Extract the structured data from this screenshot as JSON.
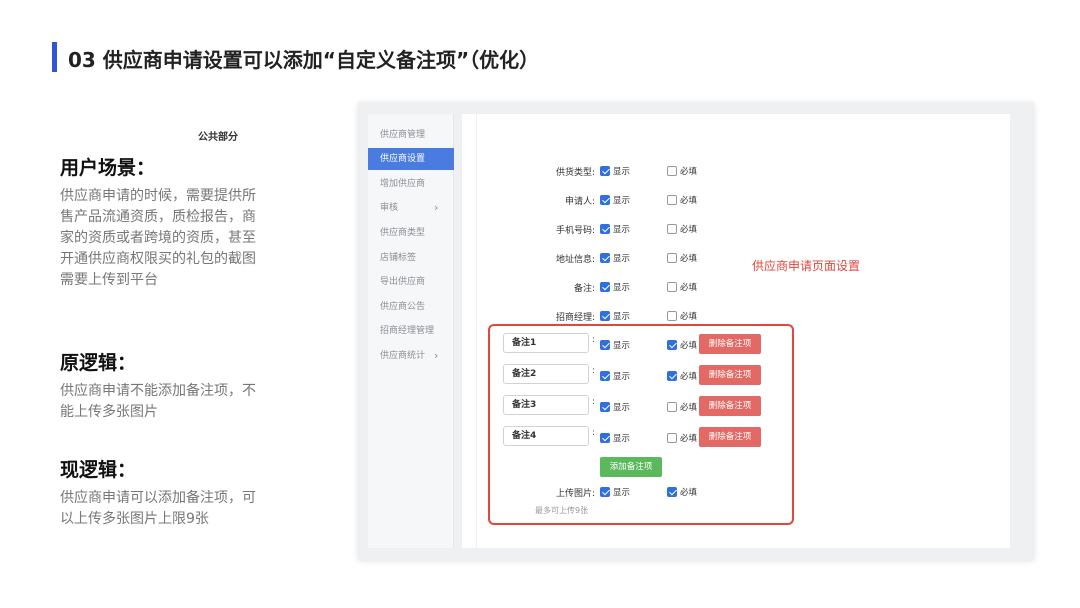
{
  "title": "03 供应商申请设置可以添加“自定义备注项”（优化）",
  "left": {
    "scenario": {
      "heading": "用户场景：",
      "body": "供应商申请的时候，需要提供所售产品流通资质，质检报告，商家的资质或者跨境的资质，甚至开通供应商权限买的礼包的截图需要上传到平台"
    },
    "old": {
      "heading": "原逻辑：",
      "body": "供应商申请不能添加备注项，不能上传多张图片"
    },
    "new": {
      "heading": "现逻辑：",
      "body": "供应商申请可以添加备注项，可以上传多张图片上限9张"
    }
  },
  "sidebar": {
    "items": [
      {
        "label": "供应商管理",
        "active": false,
        "arrow": ""
      },
      {
        "label": "供应商设置",
        "active": true,
        "arrow": ""
      },
      {
        "label": "增加供应商",
        "active": false,
        "arrow": ""
      },
      {
        "label": "审核",
        "active": false,
        "arrow": "›"
      },
      {
        "label": "供应商类型",
        "active": false,
        "arrow": ""
      },
      {
        "label": "店铺标签",
        "active": false,
        "arrow": ""
      },
      {
        "label": "导出供应商",
        "active": false,
        "arrow": ""
      },
      {
        "label": "供应商公告",
        "active": false,
        "arrow": ""
      },
      {
        "label": "招商经理管理",
        "active": false,
        "arrow": ""
      },
      {
        "label": "供应商统计",
        "active": false,
        "arrow": "›"
      }
    ]
  },
  "form": {
    "section_title": "公共部分",
    "show_label": "显示",
    "required_label": "必填",
    "fields": [
      {
        "label": "供货类型:",
        "show": true,
        "required": false
      },
      {
        "label": "申请人:",
        "show": true,
        "required": false
      },
      {
        "label": "手机号码:",
        "show": true,
        "required": false
      },
      {
        "label": "地址信息:",
        "show": true,
        "required": false
      },
      {
        "label": "备注:",
        "show": true,
        "required": false
      },
      {
        "label": "招商经理:",
        "show": true,
        "required": false
      }
    ],
    "notes": [
      {
        "value": "备注1",
        "show": true,
        "required": true,
        "delete_label": "删除备注项"
      },
      {
        "value": "备注2",
        "show": true,
        "required": true,
        "delete_label": "删除备注项"
      },
      {
        "value": "备注3",
        "show": true,
        "required": false,
        "delete_label": "删除备注项"
      },
      {
        "value": "备注4",
        "show": true,
        "required": false,
        "delete_label": "删除备注项"
      }
    ],
    "add_label": "添加备注项",
    "upload": {
      "label": "上传图片:",
      "show": true,
      "required": true,
      "hint": "最多可上传9张"
    }
  },
  "annotation": "供应商申请页面设置",
  "colors": {
    "accent": "#2f55d4",
    "highlight": "#e0473d",
    "delete": "#e36a64",
    "add": "#5cb85c",
    "checkbox": "#2f6fe0"
  }
}
